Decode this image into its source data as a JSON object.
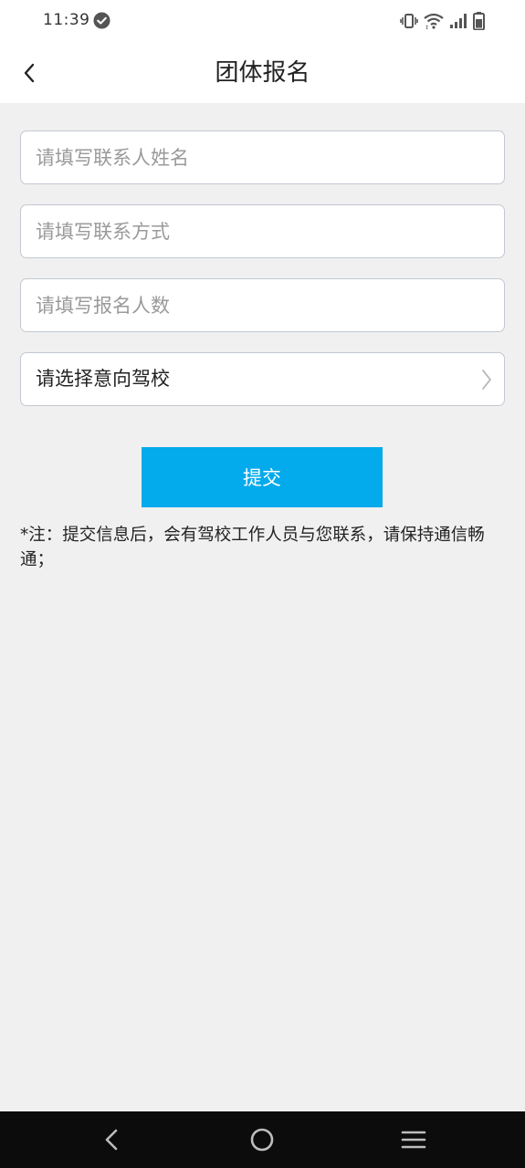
{
  "status_bar": {
    "time": "11:39",
    "icons": [
      "check-circle-icon",
      "vibrate-icon",
      "wifi-icon",
      "signal-icon",
      "battery-icon"
    ]
  },
  "app_bar": {
    "title": "团体报名",
    "back_icon": "chevron-left-icon"
  },
  "form": {
    "contact_name": {
      "placeholder": "请填写联系人姓名",
      "value": ""
    },
    "contact_method": {
      "placeholder": "请填写联系方式",
      "value": ""
    },
    "headcount": {
      "placeholder": "请填写报名人数",
      "value": ""
    },
    "school_select": {
      "label": "请选择意向驾校",
      "icon": "chevron-right-icon"
    }
  },
  "submit": {
    "label": "提交"
  },
  "note": "*注：提交信息后，会有驾校工作人员与您联系，请保持通信畅通；",
  "nav_bar": {
    "icons": [
      "back-triangle-icon",
      "home-circle-icon",
      "menu-lines-icon"
    ]
  },
  "colors": {
    "accent": "#03aaec",
    "background": "#f0f0f0",
    "nav_bar": "#0c0c0c"
  }
}
